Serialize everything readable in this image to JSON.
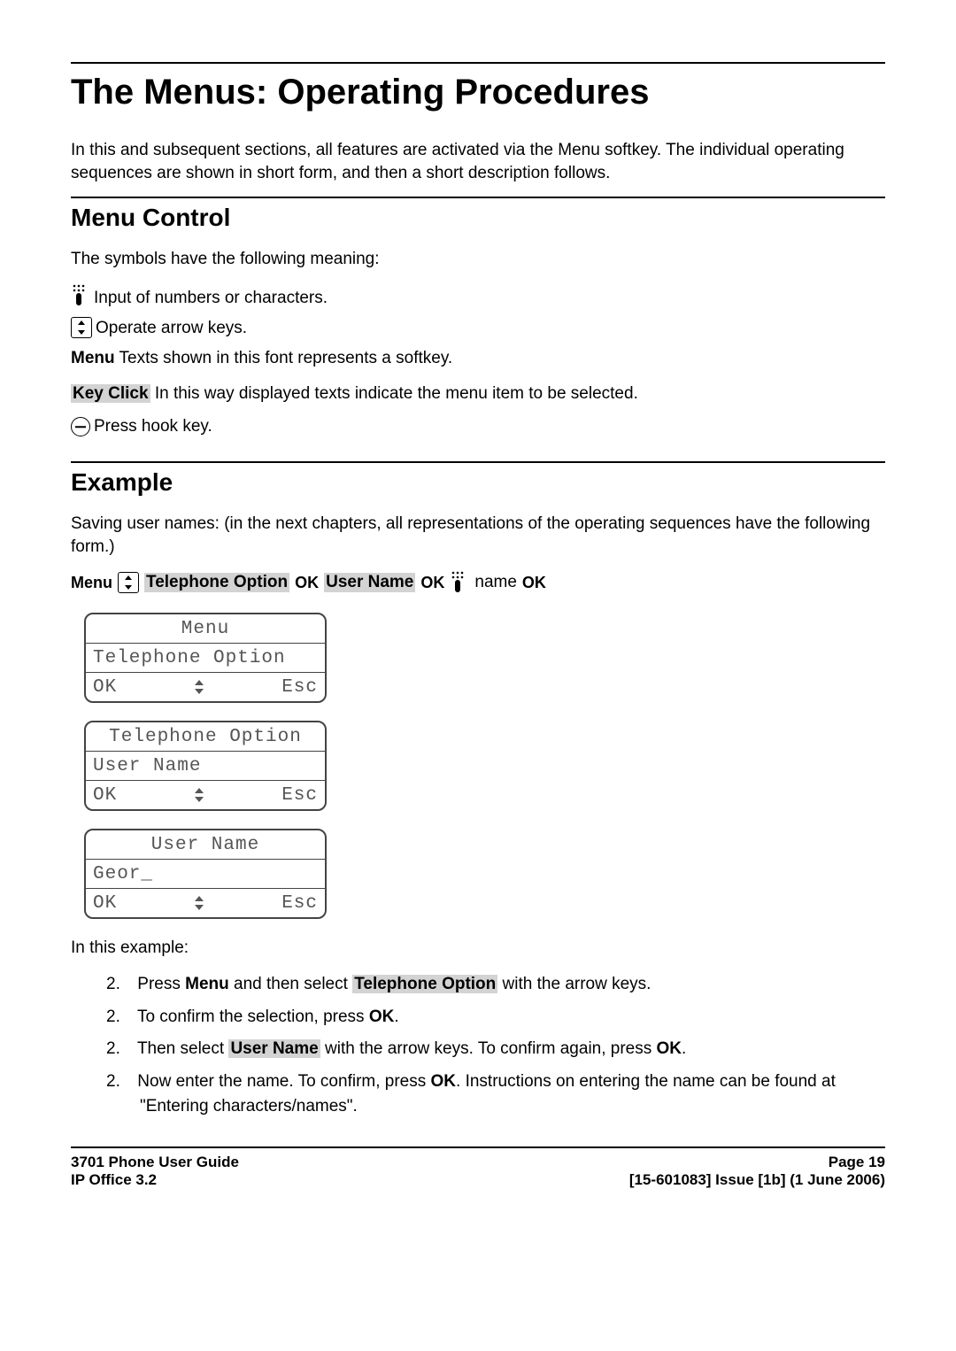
{
  "title": "The Menus: Operating Procedures",
  "intro": "In this and subsequent sections, all features are activated via the Menu softkey. The individual operating sequences are shown in short form, and then a short description follows.",
  "section_menu_control": {
    "heading": "Menu Control",
    "lead": "The symbols have the following meaning:",
    "items": {
      "keypad": " Input of numbers or characters.",
      "arrows": "Operate arrow keys.",
      "menu_label": "Menu",
      "menu_text": " Texts shown in this font represents a softkey.",
      "keyclick_label": "Key Click",
      "keyclick_text": " In this way displayed texts indicate the menu item to be selected.",
      "hook": "Press hook key."
    }
  },
  "section_example": {
    "heading": "Example",
    "lead": "Saving user names: (in the next chapters, all representations of the operating sequences have the following form.)",
    "sequence": {
      "menu": "Menu",
      "tel_opt": "Telephone Option",
      "ok1": "OK",
      "user_name": "User Name",
      "ok2": "OK",
      "name": " name ",
      "ok3": "OK"
    },
    "screens": [
      {
        "title": "Menu",
        "line": "Telephone Option",
        "ok": "OK",
        "esc": "Esc"
      },
      {
        "title": "Telephone Option",
        "line": "User Name",
        "ok": "OK",
        "esc": "Esc"
      },
      {
        "title": "User Name",
        "line": "Geor_",
        "ok": "OK",
        "esc": "Esc"
      }
    ],
    "in_this_example": "In this example:",
    "steps_numbered_label": "2.",
    "steps": [
      {
        "pre": "Press ",
        "b1": "Menu",
        "mid": " and then select ",
        "hl": "Telephone Option",
        "post": " with the arrow keys."
      },
      {
        "pre": "To confirm the selection, press ",
        "b1": "OK",
        "post": "."
      },
      {
        "pre": "Then select ",
        "hl": "User Name",
        "mid": " with the arrow keys. To confirm again, press ",
        "b1": "OK",
        "post": "."
      },
      {
        "pre": "Now enter the name. To confirm, press ",
        "b1": "OK",
        "post": ". Instructions on entering the name can be found at \"Entering characters/names\"."
      }
    ]
  },
  "footer": {
    "left1": "3701 Phone User Guide",
    "left2": "IP Office 3.2",
    "right1": "Page 19",
    "right2": "[15-601083] Issue [1b] (1 June 2006)"
  }
}
